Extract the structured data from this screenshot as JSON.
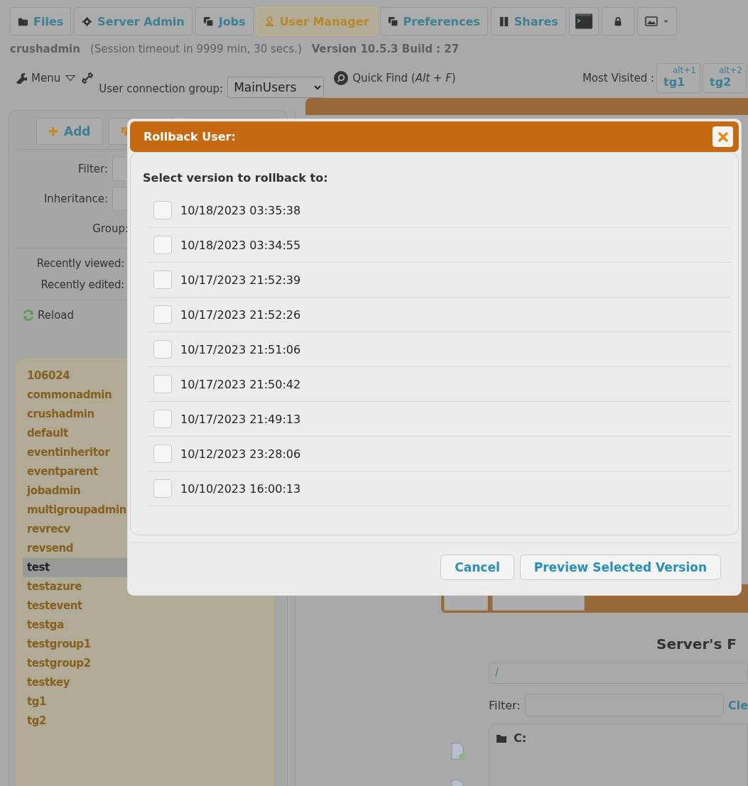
{
  "tabs": [
    {
      "label": "Files",
      "selected": false
    },
    {
      "label": "Server Admin",
      "selected": false
    },
    {
      "label": "Jobs",
      "selected": false
    },
    {
      "label": "User Manager",
      "selected": true
    },
    {
      "label": "Preferences",
      "selected": false
    },
    {
      "label": "Shares",
      "selected": false
    }
  ],
  "session": {
    "user": "crushadmin",
    "timeout": "(Session timeout in 9999 min, 30 secs.)",
    "version": "Version 10.5.3 Build : 27"
  },
  "toolbar": {
    "menu": "Menu",
    "group_label": "User connection group:",
    "group_value": "MainUsers",
    "quick_find": "Quick Find (*Alt* + *F*)",
    "most_visited_label": "Most Visited :",
    "most_visited": [
      {
        "shortcut": "alt+1",
        "label": "tg1"
      },
      {
        "shortcut": "alt+2",
        "label": "tg2"
      }
    ]
  },
  "user_panel": {
    "add_button": "Add",
    "filters": [
      "Filter:",
      "Inheritance:",
      "Group:"
    ],
    "recent": [
      "Recently viewed:",
      "Recently edited:"
    ],
    "reload": "Reload",
    "users": [
      {
        "name": "106024",
        "selected": false
      },
      {
        "name": "commonadmin",
        "selected": false
      },
      {
        "name": "crushadmin",
        "selected": false
      },
      {
        "name": "default",
        "selected": false
      },
      {
        "name": "eventinheritor",
        "selected": false
      },
      {
        "name": "eventparent",
        "selected": false
      },
      {
        "name": "jobadmin",
        "selected": false
      },
      {
        "name": "multigroupadmin",
        "selected": false
      },
      {
        "name": "revrecv",
        "selected": false
      },
      {
        "name": "revsend",
        "selected": false
      },
      {
        "name": "test",
        "selected": true
      },
      {
        "name": "testazure",
        "selected": false
      },
      {
        "name": "testevent",
        "selected": false
      },
      {
        "name": "testga",
        "selected": false
      },
      {
        "name": "testgroup1",
        "selected": false
      },
      {
        "name": "testgroup2",
        "selected": false
      },
      {
        "name": "testkey",
        "selected": false
      },
      {
        "name": "tg1",
        "selected": false
      },
      {
        "name": "tg2",
        "selected": false
      }
    ]
  },
  "vfs": {
    "server_title": "Server's F",
    "path": "/",
    "filter_label": "Filter:",
    "clear_link": "Cle",
    "tree": [
      {
        "name": "C:"
      }
    ]
  },
  "dialog": {
    "title": "Rollback User:",
    "prompt": "Select version to rollback to:",
    "versions": [
      {
        "date": "10/18/2023 03:35:38",
        "checked": false
      },
      {
        "date": "10/18/2023 03:34:55",
        "checked": false
      },
      {
        "date": "10/17/2023 21:52:39",
        "checked": false
      },
      {
        "date": "10/17/2023 21:52:26",
        "checked": false
      },
      {
        "date": "10/17/2023 21:51:06",
        "checked": false
      },
      {
        "date": "10/17/2023 21:50:42",
        "checked": false
      },
      {
        "date": "10/17/2023 21:49:13",
        "checked": false
      },
      {
        "date": "10/12/2023 23:28:06",
        "checked": false
      },
      {
        "date": "10/10/2023 16:00:13",
        "checked": false
      }
    ],
    "buttons": [
      "Cancel",
      "Preview Selected Version"
    ]
  }
}
